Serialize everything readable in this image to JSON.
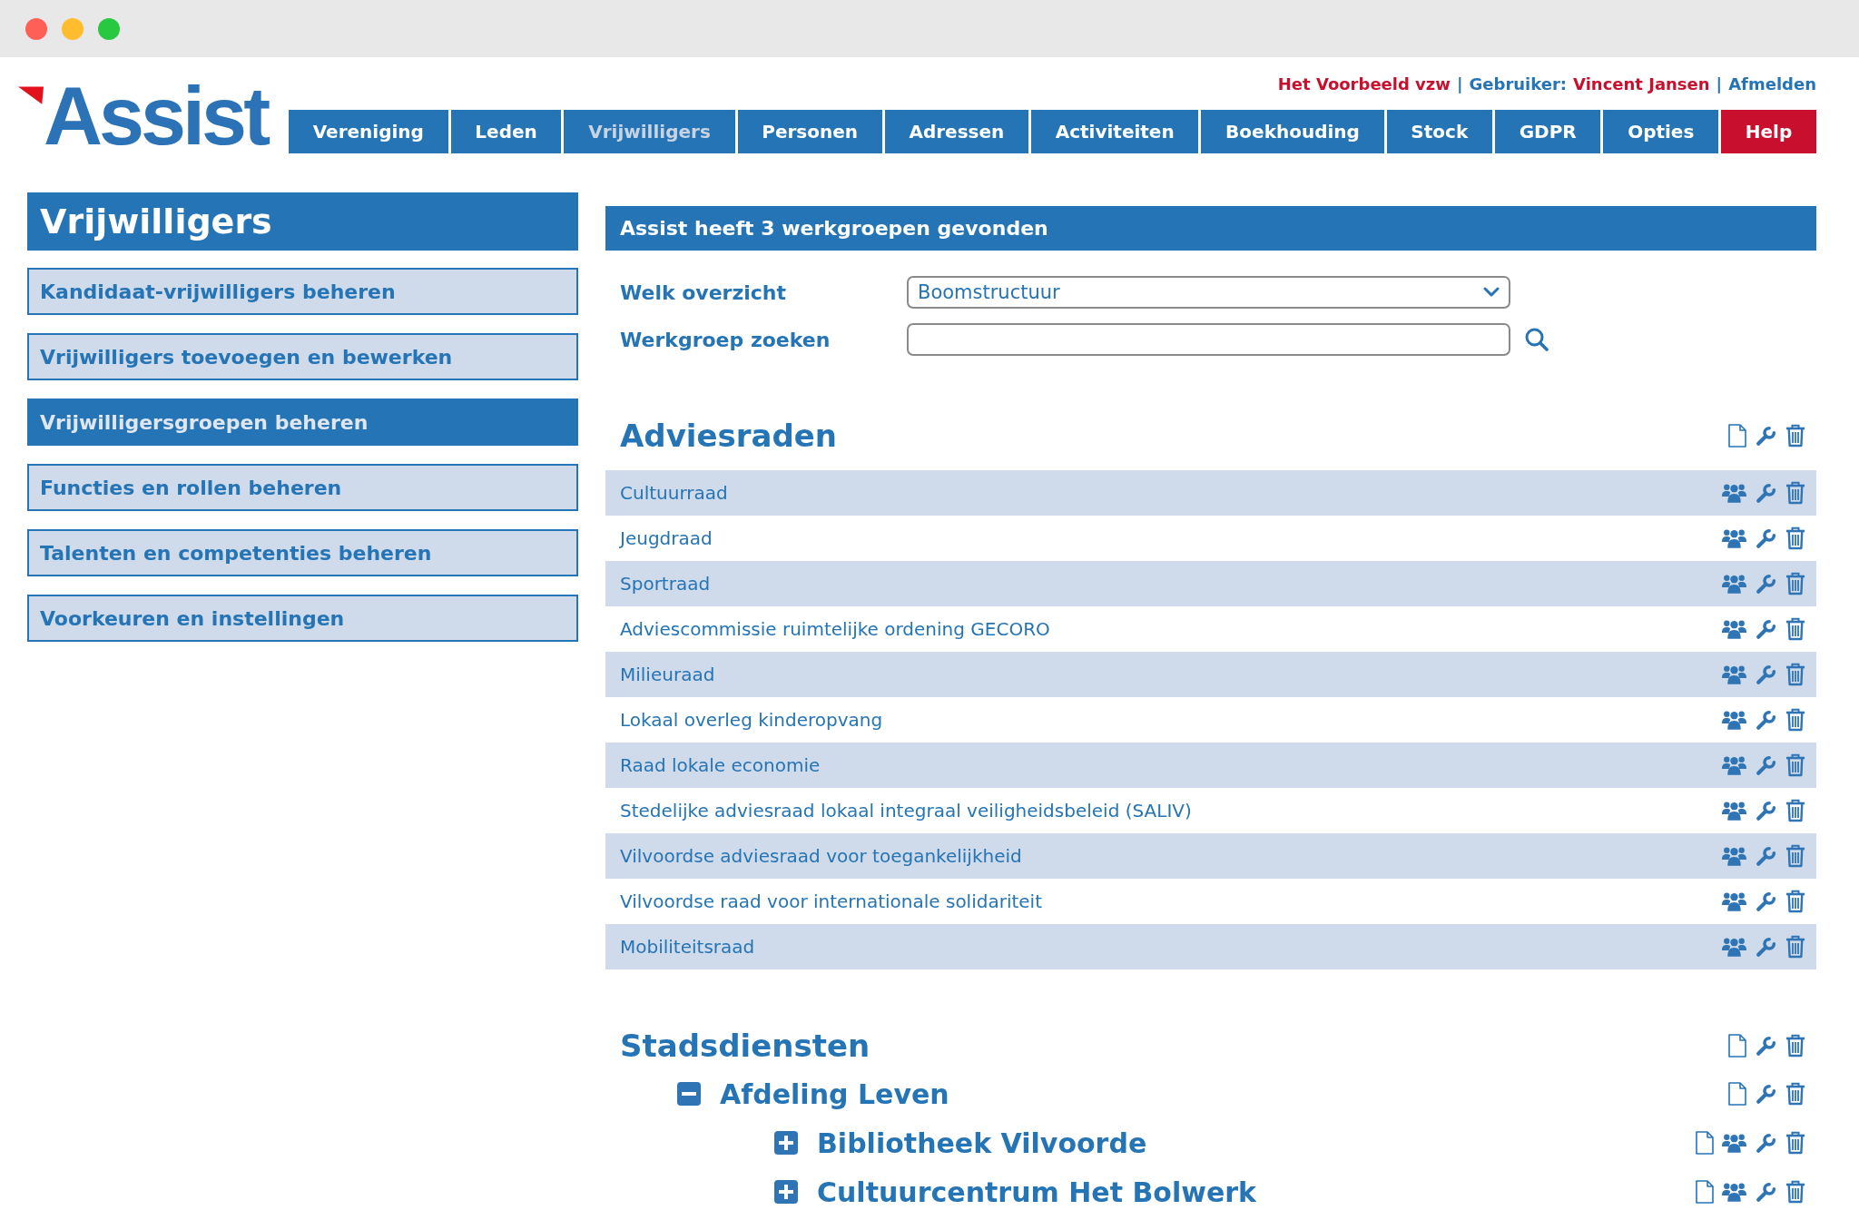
{
  "logo": "Assist",
  "user_bar": [
    {
      "kind": "organization",
      "text": "Het Voorbeeld vzw"
    },
    {
      "kind": "separator",
      "text": "|"
    },
    {
      "kind": "user",
      "label": "Gebruiker:",
      "text": "Vincent Jansen"
    },
    {
      "kind": "separator",
      "text": "|"
    },
    {
      "kind": "logout",
      "text": "Afmelden"
    }
  ],
  "nav": [
    {
      "label": "Vereniging",
      "selected": false,
      "color": "#2574b5"
    },
    {
      "label": "Leden",
      "selected": false,
      "color": "#2574b5"
    },
    {
      "label": "Vrijwilligers",
      "selected": true,
      "color": "#2574b5"
    },
    {
      "label": "Personen",
      "selected": false,
      "color": "#2574b5"
    },
    {
      "label": "Adressen",
      "selected": false,
      "color": "#2574b5"
    },
    {
      "label": "Activiteiten",
      "selected": false,
      "color": "#2574b5"
    },
    {
      "label": "Boekhouding",
      "selected": false,
      "color": "#2574b5"
    },
    {
      "label": "Stock",
      "selected": false,
      "color": "#2574b5"
    },
    {
      "label": "GDPR",
      "selected": false,
      "color": "#2574b5"
    },
    {
      "label": "Opties",
      "selected": false,
      "color": "#2574b5"
    },
    {
      "label": "Help",
      "selected": false,
      "color": "#c8102e"
    }
  ],
  "sidebar": {
    "title": "Vrijwilligers",
    "items": [
      {
        "label": "Kandidaat-vrijwilligers beheren",
        "selected": false
      },
      {
        "label": "Vrijwilligers toevoegen en bewerken",
        "selected": false
      },
      {
        "label": "Vrijwilligersgroepen beheren",
        "selected": true
      },
      {
        "label": "Functies en rollen beheren",
        "selected": false
      },
      {
        "label": "Talenten en competenties beheren",
        "selected": false
      },
      {
        "label": "Voorkeuren en instellingen",
        "selected": false
      }
    ]
  },
  "results": {
    "title": "Assist heeft 3 werkgroepen gevonden",
    "view_select": {
      "label": "Welk overzicht",
      "value": "Boomstructuur"
    },
    "search": {
      "label": "Werkgroep zoeken"
    },
    "tree": [
      {
        "kind": "category",
        "name": "Adviesraden",
        "children": [
          {
            "kind": "group",
            "name": "Cultuurraad"
          },
          {
            "kind": "group",
            "name": "Jeugdraad"
          },
          {
            "kind": "group",
            "name": "Sportraad"
          },
          {
            "kind": "group",
            "name": "Adviescommissie ruimtelijke ordening GECORO"
          },
          {
            "kind": "group",
            "name": "Milieuraad"
          },
          {
            "kind": "group",
            "name": "Lokaal overleg kinderopvang"
          },
          {
            "kind": "group",
            "name": "Raad lokale economie"
          },
          {
            "kind": "group",
            "name": "Stedelijke adviesraad lokaal integraal veiligheidsbeleid (SALIV)"
          },
          {
            "kind": "group",
            "name": "Vilvoordse adviesraad voor toegankelijkheid"
          },
          {
            "kind": "group",
            "name": "Vilvoordse raad voor internationale solidariteit"
          },
          {
            "kind": "group",
            "name": "Mobiliteitsraad"
          }
        ]
      },
      {
        "kind": "category",
        "name": "Stadsdiensten",
        "children": [
          {
            "kind": "category",
            "name": "Afdeling Leven",
            "expanded": true,
            "children": [
              {
                "kind": "parent-group",
                "name": "Bibliotheek Vilvoorde",
                "expanded": false
              },
              {
                "kind": "parent-group",
                "name": "Cultuurcentrum Het Bolwerk",
                "expanded": false
              }
            ]
          }
        ]
      }
    ]
  }
}
